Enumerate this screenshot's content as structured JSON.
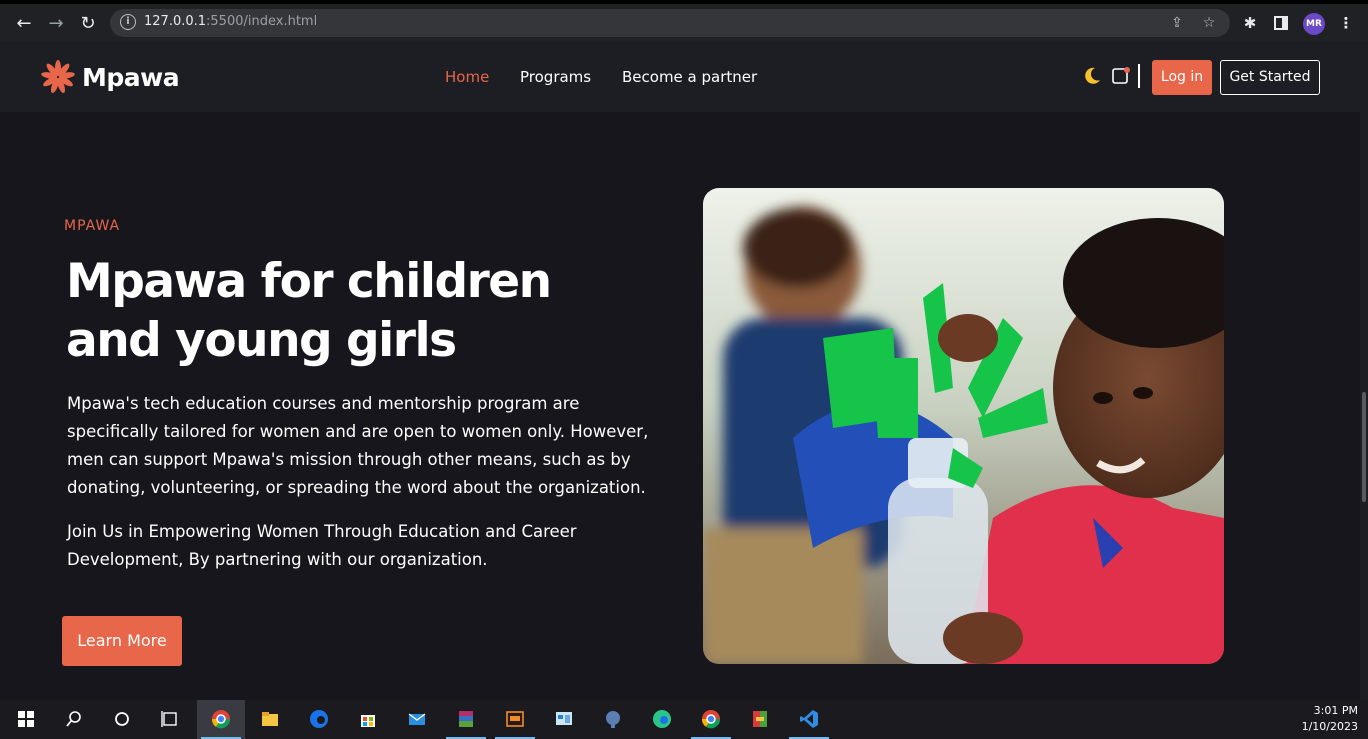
{
  "browser": {
    "url_host": "127.0.0.1",
    "url_rest": ":5500/index.html",
    "profile_initials": "MR",
    "icons": [
      "back-icon",
      "forward-icon",
      "reload-icon",
      "info-icon",
      "share-icon",
      "star-icon",
      "extensions-icon",
      "sidepanel-icon",
      "menu-icon"
    ]
  },
  "site": {
    "brand": "Mpawa",
    "nav": [
      "Home",
      "Programs",
      "Become a partner"
    ],
    "active_nav": "Home",
    "login_label": "Log in",
    "get_started_label": "Get Started",
    "accent_color": "#e8664a"
  },
  "hero": {
    "eyebrow": "MPAWA",
    "title_line1": "Mpawa for children",
    "title_line2": "and young girls",
    "paragraph1": "Mpawa's tech education courses and mentorship program are specifically tailored for women and are open to women only. However, men can support Mpawa's mission through other means, such as by donating, volunteering, or spreading the word about the organization.",
    "paragraph2": "Join Us in Empowering Women Through Education and Career Development, By partnering with our organization.",
    "cta_label": "Learn More"
  },
  "taskbar": {
    "time": "3:01 PM",
    "date": "1/10/2023",
    "apps": [
      "windows-start-icon",
      "search-icon",
      "cortana-icon",
      "task-view-icon",
      "chrome-icon",
      "file-explorer-icon",
      "edge-icon",
      "store-icon",
      "mail-icon",
      "winrar-icon",
      "app-icon",
      "control-panel-icon",
      "postgres-icon",
      "edge-icon",
      "chrome-icon",
      "winrar-icon",
      "vscode-icon"
    ]
  }
}
